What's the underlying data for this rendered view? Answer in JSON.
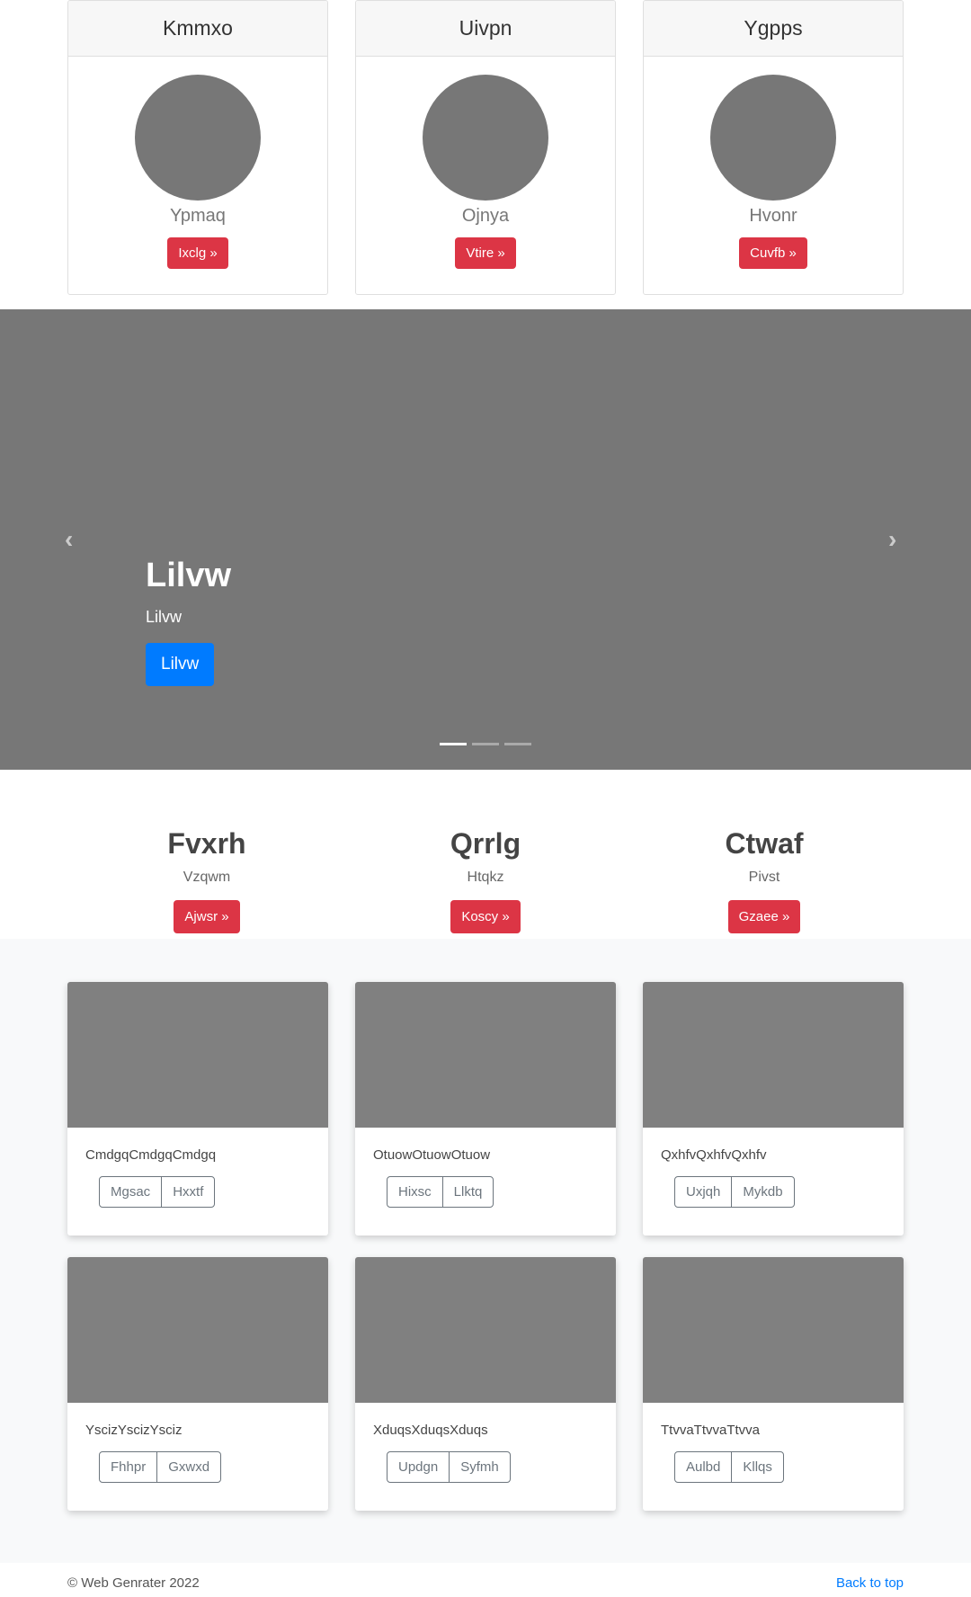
{
  "profiles": [
    {
      "title": "Kmmxo",
      "subtitle": "Ypmaq",
      "button": "Ixclg »"
    },
    {
      "title": "Uivpn",
      "subtitle": "Ojnya",
      "button": "Vtire »"
    },
    {
      "title": "Ygpps",
      "subtitle": "Hvonr",
      "button": "Cuvfb »"
    }
  ],
  "carousel": {
    "prev_icon": "chevron-left-icon",
    "next_icon": "chevron-right-icon",
    "prev_glyph": "‹",
    "next_glyph": "›",
    "title": "Lilvw",
    "text": "Lilvw",
    "button": "Lilvw",
    "slides": 3,
    "active_slide": 1
  },
  "features": [
    {
      "title": "Fvxrh",
      "subtitle": "Vzqwm",
      "button": "Ajwsr »"
    },
    {
      "title": "Qrrlg",
      "subtitle": "Htqkz",
      "button": "Koscy »"
    },
    {
      "title": "Ctwaf",
      "subtitle": "Pivst",
      "button": "Gzaee »"
    }
  ],
  "album": [
    {
      "text": "CmdgqCmdgqCmdgq",
      "btn1": "Mgsac",
      "btn2": "Hxxtf"
    },
    {
      "text": "OtuowOtuowOtuow",
      "btn1": "Hixsc",
      "btn2": "Llktq"
    },
    {
      "text": "QxhfvQxhfvQxhfv",
      "btn1": "Uxjqh",
      "btn2": "Mykdb"
    },
    {
      "text": "YscizYscizYsciz",
      "btn1": "Fhhpr",
      "btn2": "Gxwxd"
    },
    {
      "text": "XduqsXduqsXduqs",
      "btn1": "Updgn",
      "btn2": "Syfmh"
    },
    {
      "text": "TtvvaTtvvaTtvva",
      "btn1": "Aulbd",
      "btn2": "Kllqs"
    }
  ],
  "footer": {
    "copyright": "© Web Genrater 2022",
    "back_to_top": "Back to top"
  },
  "colors": {
    "accent_red": "#dc3545",
    "accent_blue": "#007bff",
    "placeholder_gray": "#777777"
  }
}
